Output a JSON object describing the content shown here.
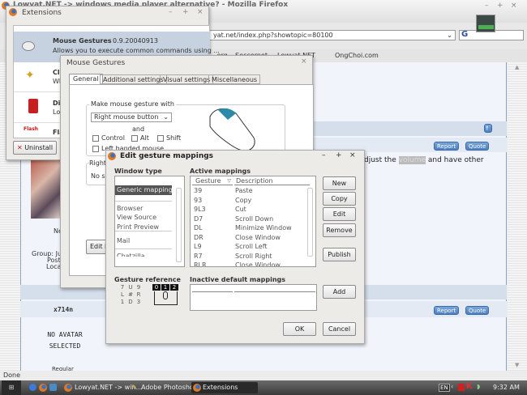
{
  "browser": {
    "title": "Lowyat.NET -> windows media player alternative? - Mozilla Firefox",
    "url": "yat.net/index.php?showtopic=80100",
    "bookmarks": [
      ".org",
      "Soccernet",
      "Lowyat.NET",
      "OngChoi.com"
    ],
    "status": "Done"
  },
  "forum": {
    "post_text_before": "djust the",
    "post_highlight": "volume",
    "post_text_after": "and have other",
    "report_label": "Report",
    "quote_label": "Quote",
    "user1_name": "Ne",
    "user1_group": "Group: Ju",
    "user1_posts": "Post",
    "user1_location": "Loca",
    "user2_name": "x714n",
    "no_avatar_line1": "NO AVATAR",
    "no_avatar_line2": "SELECTED",
    "user2_rank": "Regular"
  },
  "extensions": {
    "title": "Extensions",
    "items": [
      {
        "name": "Mouse Gestures",
        "version": "0.9.20040913",
        "desc": "Allows you to execute common commands using ..."
      },
      {
        "name": "Clos",
        "desc": "Whe"
      },
      {
        "name": "Dicti",
        "desc": "Look"
      },
      {
        "name": "Flas",
        "desc": "",
        "icon_text": "Flash"
      }
    ],
    "uninstall_label": "Uninstall"
  },
  "mouse_gestures": {
    "title": "Mouse Gestures",
    "tabs": [
      "General",
      "Additional settings",
      "Visual settings",
      "Miscellaneous"
    ],
    "group_label": "Make mouse gesture with",
    "button_select": "Right mouse button",
    "and_label": "and",
    "modifiers": [
      "Control",
      "Alt",
      "Shift"
    ],
    "left_handed": "Left handed mouse",
    "right_group": "Right",
    "right_text": "No sp",
    "edit_button": "Edit M"
  },
  "edit_mappings": {
    "title": "Edit gesture mappings",
    "window_type_label": "Window type",
    "window_types": [
      "Generic mappings",
      "Browser",
      "View Source",
      "Print Preview",
      "Mail",
      "Chatzilla"
    ],
    "active_label": "Active mappings",
    "columns": [
      "Gesture",
      "Description"
    ],
    "mappings": [
      [
        "39",
        "Paste"
      ],
      [
        "93",
        "Copy"
      ],
      [
        "9L3",
        "Cut"
      ],
      [
        "D7",
        "Scroll Down"
      ],
      [
        "DL",
        "Minimize Window"
      ],
      [
        "DR",
        "Close Window"
      ],
      [
        "L9",
        "Scroll Left"
      ],
      [
        "R7",
        "Scroll Right"
      ],
      [
        "RLR",
        "Close Window"
      ]
    ],
    "buttons": {
      "new": "New",
      "copy": "Copy",
      "edit": "Edit",
      "remove": "Remove",
      "publish": "Publish",
      "add": "Add",
      "ok": "OK",
      "cancel": "Cancel"
    },
    "gesture_ref_label": "Gesture reference",
    "gesture_grid": [
      "7",
      "U",
      "9",
      "L",
      "R",
      "1",
      "D",
      "3"
    ],
    "mouse_buttons": [
      "0",
      "1",
      "2"
    ],
    "inactive_label": "Inactive default mappings"
  },
  "taskbar": {
    "tasks": [
      "Lowyat.NET -> win...",
      "Adobe Photoshop",
      "Extensions"
    ],
    "lang": "EN",
    "clock": "9:32 AM"
  }
}
